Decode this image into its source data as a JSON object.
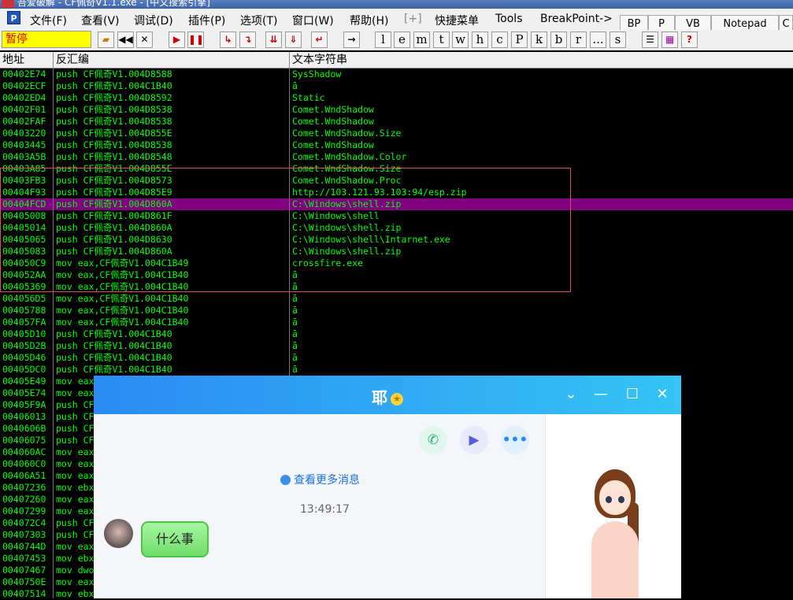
{
  "window": {
    "title": "吾爱破解 - CF佩奇V1.1.exe - [中文搜索引擎]"
  },
  "menubar": {
    "items": [
      "文件(F)",
      "查看(V)",
      "调试(D)",
      "插件(P)",
      "选项(T)",
      "窗口(W)",
      "帮助(H)",
      "[+]",
      "快捷菜单",
      "Tools",
      "BreakPoint->"
    ],
    "tabs": [
      "BP",
      "P",
      "VB",
      "Notepad",
      "C"
    ]
  },
  "toolbar": {
    "status": "暂停",
    "letters": [
      "l",
      "e",
      "m",
      "t",
      "w",
      "h",
      "c",
      "P",
      "k",
      "b",
      "r",
      "...",
      "s"
    ]
  },
  "columns": [
    "地址",
    "反汇编",
    "文本字符串"
  ],
  "rows": [
    {
      "addr": "00402E74",
      "asm": "push CF佩奇V1.004D8588",
      "text": "SysShadow"
    },
    {
      "addr": "00402ECF",
      "asm": "push CF佩奇V1.004C1B40",
      "text": "ā"
    },
    {
      "addr": "00402ED4",
      "asm": "push CF佩奇V1.004D8592",
      "text": "Static"
    },
    {
      "addr": "00402F01",
      "asm": "push CF佩奇V1.004D8538",
      "text": "Comet.WndShadow"
    },
    {
      "addr": "00402FAF",
      "asm": "push CF佩奇V1.004D8538",
      "text": "Comet.WndShadow"
    },
    {
      "addr": "00403220",
      "asm": "push CF佩奇V1.004D855E",
      "text": "Comet.WndShadow.Size"
    },
    {
      "addr": "00403445",
      "asm": "push CF佩奇V1.004D8538",
      "text": "Comet.WndShadow"
    },
    {
      "addr": "00403A5B",
      "asm": "push CF佩奇V1.004D8548",
      "text": "Comet.WndShadow.Color"
    },
    {
      "addr": "00403A85",
      "asm": "push CF佩奇V1.004D855E",
      "text": "Comet.WndShadow.Size"
    },
    {
      "addr": "00403FB3",
      "asm": "push CF佩奇V1.004D8573",
      "text": "Comet.WndShadow.Proc"
    },
    {
      "addr": "00404F93",
      "asm": "push CF佩奇V1.004D85E9",
      "text": "http://103.121.93.103:94/esp.zip"
    },
    {
      "addr": "00404FCD",
      "asm": "push CF佩奇V1.004D860A",
      "text": "C:\\Windows\\shell.zip"
    },
    {
      "addr": "00405008",
      "asm": "push CF佩奇V1.004D861F",
      "text": "C:\\Windows\\shell"
    },
    {
      "addr": "00405014",
      "asm": "push CF佩奇V1.004D860A",
      "text": "C:\\Windows\\shell.zip"
    },
    {
      "addr": "00405065",
      "asm": "push CF佩奇V1.004D8630",
      "text": "C:\\Windows\\shell\\Intarnet.exe"
    },
    {
      "addr": "00405083",
      "asm": "push CF佩奇V1.004D860A",
      "text": "C:\\Windows\\shell.zip"
    },
    {
      "addr": "004050C9",
      "asm": "mov eax,CF佩奇V1.004C1B49",
      "text": "crossfire.exe"
    },
    {
      "addr": "004052AA",
      "asm": "mov eax,CF佩奇V1.004C1B40",
      "text": "ā"
    },
    {
      "addr": "00405369",
      "asm": "mov eax,CF佩奇V1.004C1B40",
      "text": "ā"
    },
    {
      "addr": "004056D5",
      "asm": "mov eax,CF佩奇V1.004C1B40",
      "text": "ā"
    },
    {
      "addr": "00405788",
      "asm": "mov eax,CF佩奇V1.004C1B40",
      "text": "ā"
    },
    {
      "addr": "004057FA",
      "asm": "mov eax,CF佩奇V1.004C1B40",
      "text": "ā"
    },
    {
      "addr": "00405D10",
      "asm": "push CF佩奇V1.004C1B40",
      "text": "ā"
    },
    {
      "addr": "00405D2B",
      "asm": "push CF佩奇V1.004C1B40",
      "text": "ā"
    },
    {
      "addr": "00405D46",
      "asm": "push CF佩奇V1.004C1B40",
      "text": "ā"
    },
    {
      "addr": "00405DC0",
      "asm": "push CF佩奇V1.004C1B40",
      "text": "ā"
    },
    {
      "addr": "00405E49",
      "asm": "mov eax",
      "text": ""
    },
    {
      "addr": "00405E74",
      "asm": "mov eax",
      "text": ""
    },
    {
      "addr": "00405F9A",
      "asm": "push CF",
      "text": ""
    },
    {
      "addr": "00406013",
      "asm": "push CF",
      "text": ""
    },
    {
      "addr": "0040606B",
      "asm": "push CF",
      "text": ""
    },
    {
      "addr": "00406075",
      "asm": "push CF",
      "text": ""
    },
    {
      "addr": "004060AC",
      "asm": "mov eax",
      "text": ""
    },
    {
      "addr": "004060C0",
      "asm": "mov eax",
      "text": ""
    },
    {
      "addr": "00406A51",
      "asm": "mov eax",
      "text": ""
    },
    {
      "addr": "00407236",
      "asm": "mov ebx",
      "text": ""
    },
    {
      "addr": "00407260",
      "asm": "mov eax",
      "text": ""
    },
    {
      "addr": "00407299",
      "asm": "mov eax",
      "text": ""
    },
    {
      "addr": "004072C4",
      "asm": "push CF",
      "text": ""
    },
    {
      "addr": "00407303",
      "asm": "push CF",
      "text": ""
    },
    {
      "addr": "0040744D",
      "asm": "mov eax",
      "text": ""
    },
    {
      "addr": "00407453",
      "asm": "mov ebx",
      "text": ""
    },
    {
      "addr": "00407467",
      "asm": "mov dwo",
      "text": ""
    },
    {
      "addr": "0040750E",
      "asm": "mov eax",
      "text": ""
    },
    {
      "addr": "00407514",
      "asm": "mov ebx",
      "text": ""
    }
  ],
  "chat": {
    "title": "耶",
    "more_messages": "查看更多消息",
    "timestamp": "13:49:17",
    "message": "什么事"
  }
}
